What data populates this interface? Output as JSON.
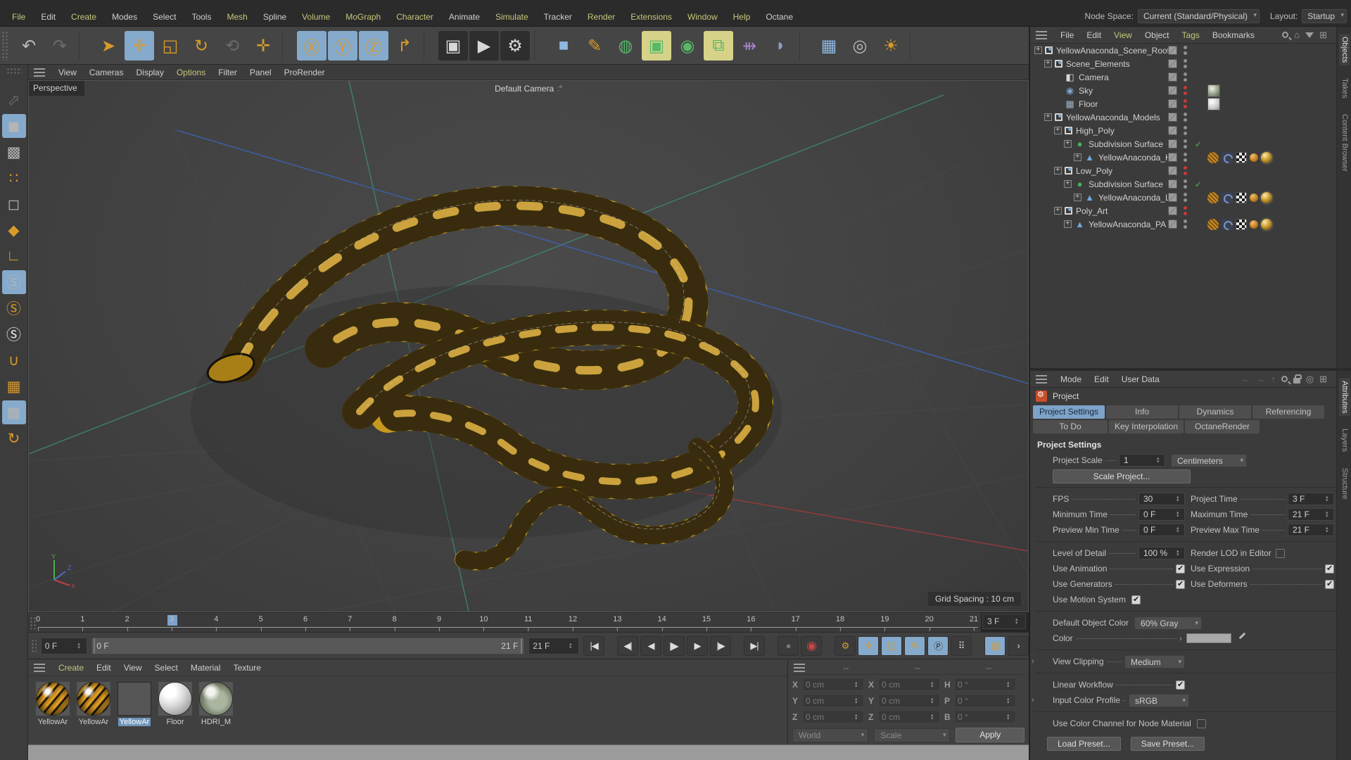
{
  "menu_bar": {
    "items": [
      {
        "label": "File",
        "tone": "y"
      },
      {
        "label": "Edit",
        "tone": "w"
      },
      {
        "label": "Create",
        "tone": "y"
      },
      {
        "label": "Modes",
        "tone": "w"
      },
      {
        "label": "Select",
        "tone": "w"
      },
      {
        "label": "Tools",
        "tone": "w"
      },
      {
        "label": "Mesh",
        "tone": "y"
      },
      {
        "label": "Spline",
        "tone": "w"
      },
      {
        "label": "Volume",
        "tone": "y"
      },
      {
        "label": "MoGraph",
        "tone": "y"
      },
      {
        "label": "Character",
        "tone": "y"
      },
      {
        "label": "Animate",
        "tone": "w"
      },
      {
        "label": "Simulate",
        "tone": "y"
      },
      {
        "label": "Tracker",
        "tone": "w"
      },
      {
        "label": "Render",
        "tone": "y"
      },
      {
        "label": "Extensions",
        "tone": "y"
      },
      {
        "label": "Window",
        "tone": "y"
      },
      {
        "label": "Help",
        "tone": "y"
      },
      {
        "label": "Octane",
        "tone": "w"
      }
    ],
    "node_space_label": "Node Space:",
    "node_space_value": "Current (Standard/Physical)",
    "layout_label": "Layout:",
    "layout_value": "Startup"
  },
  "main_toolbar": {
    "groups": [
      [
        {
          "name": "undo",
          "glyph": "↶",
          "color": "gray"
        },
        {
          "name": "redo",
          "glyph": "↷",
          "state": "disabled"
        }
      ],
      [
        {
          "name": "live-selection",
          "glyph": "➤"
        },
        {
          "name": "move-tool",
          "glyph": "✛",
          "state": "active"
        },
        {
          "name": "scale-tool",
          "glyph": "◱"
        },
        {
          "name": "rotate-tool",
          "glyph": "↻"
        },
        {
          "name": "last-tool",
          "glyph": "⟲",
          "state": "disabled"
        },
        {
          "name": "omni-move-tool",
          "glyph": "✛"
        }
      ],
      [
        {
          "name": "lock-x-axis",
          "glyph": "Ⓧ",
          "state": "active"
        },
        {
          "name": "lock-y-axis",
          "glyph": "Ⓨ",
          "state": "active"
        },
        {
          "name": "lock-z-axis",
          "glyph": "Ⓩ",
          "state": "active"
        },
        {
          "name": "coordinate-system",
          "glyph": "↱"
        }
      ],
      [
        {
          "name": "render-view",
          "glyph": "▣",
          "color": "dark"
        },
        {
          "name": "render-picture-viewer",
          "glyph": "▶",
          "color": "dark"
        },
        {
          "name": "render-settings",
          "glyph": "⚙",
          "color": "dark"
        }
      ],
      [
        {
          "name": "primitive-cube",
          "glyph": "■",
          "color": "blue"
        },
        {
          "name": "spline-pen",
          "glyph": "✎"
        },
        {
          "name": "generators",
          "glyph": "◍",
          "color": "green"
        },
        {
          "name": "subdivision-surface",
          "glyph": "▣",
          "color": "green",
          "state": "activeY"
        },
        {
          "name": "deformer",
          "glyph": "◉",
          "color": "green"
        },
        {
          "name": "cloner",
          "glyph": "⧉",
          "color": "green",
          "state": "activeY"
        },
        {
          "name": "fields",
          "glyph": "⇻",
          "color": "purple"
        },
        {
          "name": "arc-spline",
          "glyph": "◗",
          "color": "slate"
        }
      ],
      [
        {
          "name": "floor-object",
          "glyph": "▦",
          "color": "blue"
        },
        {
          "name": "camera-object",
          "glyph": "◎",
          "color": "gray"
        },
        {
          "name": "light-object",
          "glyph": "☀",
          "color": "white"
        }
      ]
    ]
  },
  "left_palette": {
    "items": [
      {
        "name": "make-editable",
        "glyph": "⬀",
        "state": "disabled"
      },
      {
        "name": "model-mode",
        "glyph": "◼",
        "state": "active",
        "color": "gray"
      },
      {
        "name": "texture-mode",
        "glyph": "▩",
        "color": "gray"
      },
      {
        "name": "point-mode",
        "glyph": "∷"
      },
      {
        "name": "edge-mode",
        "glyph": "◻",
        "color": "gray"
      },
      {
        "name": "polygon-mode",
        "glyph": "◆"
      },
      {
        "name": "enable-axis",
        "glyph": "∟"
      },
      {
        "name": "enable-snap",
        "glyph": "Ⓢ",
        "state": "active",
        "color": "gray"
      },
      {
        "name": "snap-3d",
        "glyph": "Ⓢ"
      },
      {
        "name": "snap-2d",
        "glyph": "Ⓢ",
        "color": "white"
      },
      {
        "name": "magnet-snap",
        "glyph": "∪"
      },
      {
        "name": "workplane",
        "glyph": "▦"
      },
      {
        "name": "lock-workplane",
        "glyph": "▦",
        "state": "active",
        "color": "gray"
      },
      {
        "name": "interactive-workplane",
        "glyph": "↻"
      }
    ]
  },
  "viewport": {
    "menu_items": [
      {
        "label": "View",
        "tone": "w"
      },
      {
        "label": "Cameras",
        "tone": "w"
      },
      {
        "label": "Display",
        "tone": "w"
      },
      {
        "label": "Options",
        "tone": "y"
      },
      {
        "label": "Filter",
        "tone": "w"
      },
      {
        "label": "Panel",
        "tone": "w"
      },
      {
        "label": "ProRender",
        "tone": "w"
      }
    ],
    "view_label": "Perspective",
    "camera_label": "Default Camera",
    "grid_spacing": "Grid Spacing : 10 cm",
    "corner_icons": [
      {
        "name": "pan-view",
        "glyph": "✛"
      },
      {
        "name": "dolly-view",
        "glyph": "↕"
      },
      {
        "name": "rotate-view",
        "glyph": "↻"
      },
      {
        "name": "toggle-view",
        "glyph": "◱"
      }
    ],
    "axis": {
      "x": "X",
      "y": "Y",
      "z": "Z"
    }
  },
  "object_manager": {
    "menu_items": [
      {
        "label": "File",
        "tone": "w"
      },
      {
        "label": "Edit",
        "tone": "w"
      },
      {
        "label": "View",
        "tone": "y"
      },
      {
        "label": "Object",
        "tone": "w"
      },
      {
        "label": "Tags",
        "tone": "y"
      },
      {
        "label": "Bookmarks",
        "tone": "w"
      }
    ],
    "side_tabs": [
      {
        "label": "Objects",
        "active": true
      },
      {
        "label": "Takes",
        "active": false
      },
      {
        "label": "Content Browser",
        "active": false
      }
    ],
    "tree_rows": [
      {
        "label": "YellowAnaconda_Scene_Root",
        "indent": 0,
        "icon": "null",
        "dots": "gray",
        "expander": true
      },
      {
        "label": "Scene_Elements",
        "indent": 1,
        "icon": "null",
        "dots": "gray",
        "expander": true
      },
      {
        "label": "Camera",
        "indent": 2,
        "icon": "camera",
        "glyph": "◧",
        "dots": "gray",
        "expander": false
      },
      {
        "label": "Sky",
        "indent": 2,
        "icon": "sky",
        "glyph": "◉",
        "dots": "red",
        "expander": false,
        "thumb": "hdri"
      },
      {
        "label": "Floor",
        "indent": 2,
        "icon": "floor",
        "glyph": "▦",
        "dots": "red",
        "expander": false,
        "thumb": "white"
      },
      {
        "label": "YellowAnaconda_Models",
        "indent": 1,
        "icon": "null",
        "dots": "gray",
        "expander": true
      },
      {
        "label": "High_Poly",
        "indent": 2,
        "icon": "null",
        "dots": "gray",
        "expander": true
      },
      {
        "label": "Subdivision Surface",
        "indent": 3,
        "icon": "sds",
        "glyph": "●",
        "dots": "gray",
        "expander": true,
        "check": true
      },
      {
        "label": "YellowAnaconda_HP",
        "indent": 4,
        "icon": "poly",
        "glyph": "▲",
        "dots": "gray",
        "expander": true,
        "tags": true
      },
      {
        "label": "Low_Poly",
        "indent": 2,
        "icon": "null",
        "dots": "red",
        "expander": true
      },
      {
        "label": "Subdivision Surface",
        "indent": 3,
        "icon": "sds",
        "glyph": "●",
        "dots": "gray",
        "expander": true,
        "check": true
      },
      {
        "label": "YellowAnaconda_LP",
        "indent": 4,
        "icon": "poly",
        "glyph": "▲",
        "dots": "gray",
        "expander": true,
        "tags": true
      },
      {
        "label": "Poly_Art",
        "indent": 2,
        "icon": "null",
        "dots": "red",
        "expander": true
      },
      {
        "label": "YellowAnaconda_PA",
        "indent": 3,
        "icon": "poly",
        "glyph": "▲",
        "dots": "gray",
        "expander": true,
        "tags": true
      }
    ],
    "tag_set": [
      "texture-tag",
      "weights-tag",
      "uv-tag",
      "phong-tag",
      "material-tag"
    ]
  },
  "attribute_manager": {
    "menu_items": [
      {
        "label": "Mode",
        "tone": "w"
      },
      {
        "label": "Edit",
        "tone": "w"
      },
      {
        "label": "User Data",
        "tone": "w"
      }
    ],
    "side_tabs": [
      {
        "label": "Attributes",
        "active": true
      },
      {
        "label": "Layers",
        "active": false
      },
      {
        "label": "Structure",
        "active": false
      }
    ],
    "object_title": "Project",
    "tabs_row1": [
      {
        "label": "Project Settings",
        "active": true
      },
      {
        "label": "Info",
        "active": false
      },
      {
        "label": "Dynamics",
        "active": false
      },
      {
        "label": "Referencing",
        "active": false
      }
    ],
    "tabs_row2": [
      {
        "label": "To Do",
        "active": false
      },
      {
        "label": "Key Interpolation",
        "active": false
      },
      {
        "label": "OctaneRender",
        "active": false
      }
    ],
    "section_title": "Project Settings",
    "project_scale": {
      "label": "Project Scale",
      "value": "1",
      "unit": "Centimeters"
    },
    "scale_project_button": "Scale Project...",
    "fps": {
      "label": "FPS",
      "value": "30"
    },
    "project_time": {
      "label": "Project Time",
      "value": "3 F"
    },
    "minimum_time": {
      "label": "Minimum Time",
      "value": "0 F"
    },
    "maximum_time": {
      "label": "Maximum Time",
      "value": "21 F"
    },
    "preview_min_time": {
      "label": "Preview Min Time",
      "value": "0 F"
    },
    "preview_max_time": {
      "label": "Preview Max Time",
      "value": "21 F"
    },
    "level_of_detail": {
      "label": "Level of Detail",
      "value": "100 %"
    },
    "render_lod": {
      "label": "Render LOD in Editor",
      "checked": false
    },
    "use_animation": {
      "label": "Use Animation",
      "checked": true
    },
    "use_expression": {
      "label": "Use Expression",
      "checked": true
    },
    "use_generators": {
      "label": "Use Generators",
      "checked": true
    },
    "use_deformers": {
      "label": "Use Deformers",
      "checked": true
    },
    "use_motion_system": {
      "label": "Use Motion System",
      "checked": true
    },
    "default_object_color": {
      "label": "Default Object Color",
      "value": "60% Gray"
    },
    "color": {
      "label": "Color",
      "swatch": "#a9a9a9"
    },
    "view_clipping": {
      "label": "View Clipping",
      "value": "Medium"
    },
    "linear_workflow": {
      "label": "Linear Workflow",
      "checked": true
    },
    "input_color_profile": {
      "label": "Input Color Profile",
      "value": "sRGB"
    },
    "node_material": {
      "label": "Use Color Channel for Node Material",
      "checked": false
    },
    "load_preset_button": "Load Preset...",
    "save_preset_button": "Save Preset..."
  },
  "timeline": {
    "ticks": [
      "0",
      "1",
      "2",
      "3",
      "4",
      "5",
      "6",
      "7",
      "8",
      "9",
      "10",
      "11",
      "12",
      "13",
      "14",
      "15",
      "16",
      "17",
      "18",
      "19",
      "20",
      "21"
    ],
    "current_frame": 3,
    "max_frame": 21,
    "current_frame_field": "3 F",
    "frame_spinner": "0 F",
    "range_start": "0 F",
    "range_end": "21 F",
    "range_end_spinner": "21 F"
  },
  "transport": {
    "buttons": [
      {
        "name": "goto-start",
        "glyph": "|◀"
      },
      {
        "name": "spacer"
      },
      {
        "name": "prev-key",
        "glyph": "◀|"
      },
      {
        "name": "prev-frame",
        "glyph": "◀"
      },
      {
        "name": "play",
        "glyph": "▶",
        "big": true
      },
      {
        "name": "next-frame",
        "glyph": "▶"
      },
      {
        "name": "next-key",
        "glyph": "|▶"
      },
      {
        "name": "spacer"
      },
      {
        "name": "goto-end",
        "glyph": "▶|"
      },
      {
        "name": "spacer"
      },
      {
        "name": "record-keyframe",
        "glyph": "●",
        "state": "disabled"
      },
      {
        "name": "autokeying",
        "glyph": "◉",
        "color": "red"
      },
      {
        "name": "spacer"
      },
      {
        "name": "keyframe-selection",
        "glyph": "⚙",
        "color": "orange"
      },
      {
        "name": "record-position",
        "glyph": "✛",
        "state": "active",
        "color": "orange"
      },
      {
        "name": "record-scale",
        "glyph": "◱",
        "state": "active",
        "color": "orange"
      },
      {
        "name": "record-rotation",
        "glyph": "↻",
        "state": "active",
        "color": "orange"
      },
      {
        "name": "record-parameter",
        "glyph": "Ⓟ",
        "state": "active"
      },
      {
        "name": "record-point-level",
        "glyph": "⠿"
      },
      {
        "name": "spacer"
      },
      {
        "name": "timeline-window",
        "glyph": "▤",
        "state": "active",
        "color": "orange"
      },
      {
        "name": "expand-arrow",
        "glyph": "›"
      }
    ]
  },
  "materials": {
    "menu_items": [
      {
        "label": "Create",
        "tone": "y"
      },
      {
        "label": "Edit",
        "tone": "w"
      },
      {
        "label": "View",
        "tone": "w"
      },
      {
        "label": "Select",
        "tone": "w"
      },
      {
        "label": "Material",
        "tone": "w"
      },
      {
        "label": "Texture",
        "tone": "w"
      }
    ],
    "items": [
      {
        "label": "YellowAr",
        "type": "anaconda",
        "selected": false
      },
      {
        "label": "YellowAr",
        "type": "anaconda",
        "selected": false
      },
      {
        "label": "YellowAr",
        "type": "anaconda2",
        "selected": true
      },
      {
        "label": "Floor",
        "type": "floor",
        "selected": false
      },
      {
        "label": "HDRI_M",
        "type": "hdri",
        "selected": false
      }
    ]
  },
  "coordinates": {
    "column_heads": [
      "--",
      "--",
      "--"
    ],
    "columns": [
      {
        "rows": [
          {
            "letter": "X",
            "value": "0 cm"
          },
          {
            "letter": "Y",
            "value": "0 cm"
          },
          {
            "letter": "Z",
            "value": "0 cm"
          }
        ]
      },
      {
        "rows": [
          {
            "letter": "X",
            "value": "0 cm"
          },
          {
            "letter": "Y",
            "value": "0 cm"
          },
          {
            "letter": "Z",
            "value": "0 cm"
          }
        ]
      },
      {
        "rows": [
          {
            "letter": "H",
            "value": "0 °"
          },
          {
            "letter": "P",
            "value": "0 °"
          },
          {
            "letter": "B",
            "value": "0 °"
          }
        ]
      }
    ],
    "dropdown_left": "World",
    "dropdown_right": "Scale",
    "apply_button": "Apply"
  }
}
